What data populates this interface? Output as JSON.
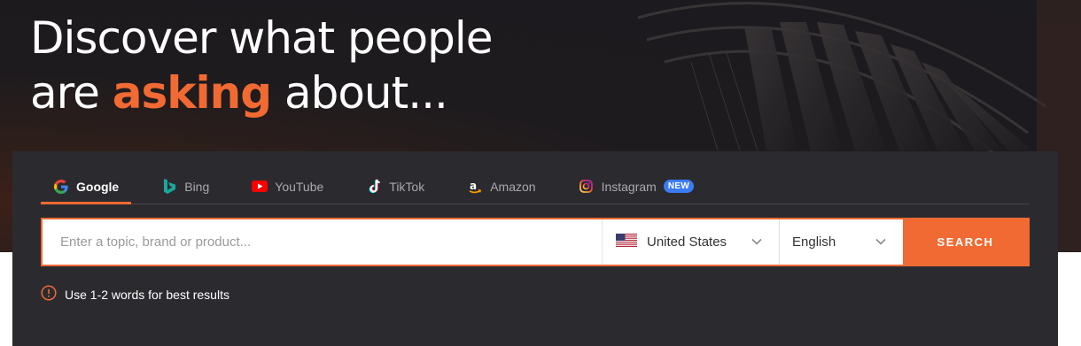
{
  "headline": {
    "line1": "Discover what people",
    "line2_prefix": "are ",
    "line2_accent": "asking",
    "line2_suffix": " about..."
  },
  "tabs": [
    {
      "label": "Google",
      "icon": "google-icon",
      "active": true
    },
    {
      "label": "Bing",
      "icon": "bing-icon",
      "active": false
    },
    {
      "label": "YouTube",
      "icon": "youtube-icon",
      "active": false
    },
    {
      "label": "TikTok",
      "icon": "tiktok-icon",
      "active": false
    },
    {
      "label": "Amazon",
      "icon": "amazon-icon",
      "active": false
    },
    {
      "label": "Instagram",
      "icon": "instagram-icon",
      "active": false,
      "badge": "NEW"
    }
  ],
  "search": {
    "placeholder": "Enter a topic, brand or product...",
    "value": "",
    "country": "United States",
    "country_icon": "us-flag-icon",
    "language": "English",
    "button_label": "SEARCH"
  },
  "hint": {
    "text": "Use 1-2 words for best results",
    "icon": "alert-circle-icon"
  },
  "colors": {
    "accent": "#f26a33",
    "badge": "#3b7bf6",
    "panel": "#2b2b2f",
    "hero": "#1b1a1f"
  }
}
